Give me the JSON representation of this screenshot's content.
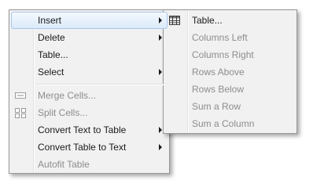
{
  "main_menu": {
    "items": [
      {
        "label": "Insert",
        "has_submenu": true,
        "highlighted": true
      },
      {
        "label": "Delete",
        "has_submenu": true
      },
      {
        "label": "Table...",
        "has_submenu": false
      },
      {
        "label": "Select",
        "has_submenu": true
      },
      {
        "label": "Merge Cells...",
        "disabled": true,
        "icon": "merge-cells-icon"
      },
      {
        "label": "Split Cells...",
        "disabled": true,
        "icon": "split-cells-icon"
      },
      {
        "label": "Convert Text to Table",
        "has_submenu": true
      },
      {
        "label": "Convert Table to Text",
        "has_submenu": true
      },
      {
        "label": "Autofit Table",
        "disabled": true
      }
    ]
  },
  "submenu": {
    "items": [
      {
        "label": "Table...",
        "icon": "table-grid-icon"
      },
      {
        "label": "Columns Left",
        "disabled": true
      },
      {
        "label": "Columns Right",
        "disabled": true
      },
      {
        "label": "Rows Above",
        "disabled": true
      },
      {
        "label": "Rows Below",
        "disabled": true
      },
      {
        "label": "Sum a Row",
        "disabled": true
      },
      {
        "label": "Sum a Column",
        "disabled": true
      }
    ]
  },
  "colors": {
    "menu_background": "#f1f1f1",
    "highlight_border": "#a9c6ea",
    "disabled_text": "#8d8d8d"
  }
}
